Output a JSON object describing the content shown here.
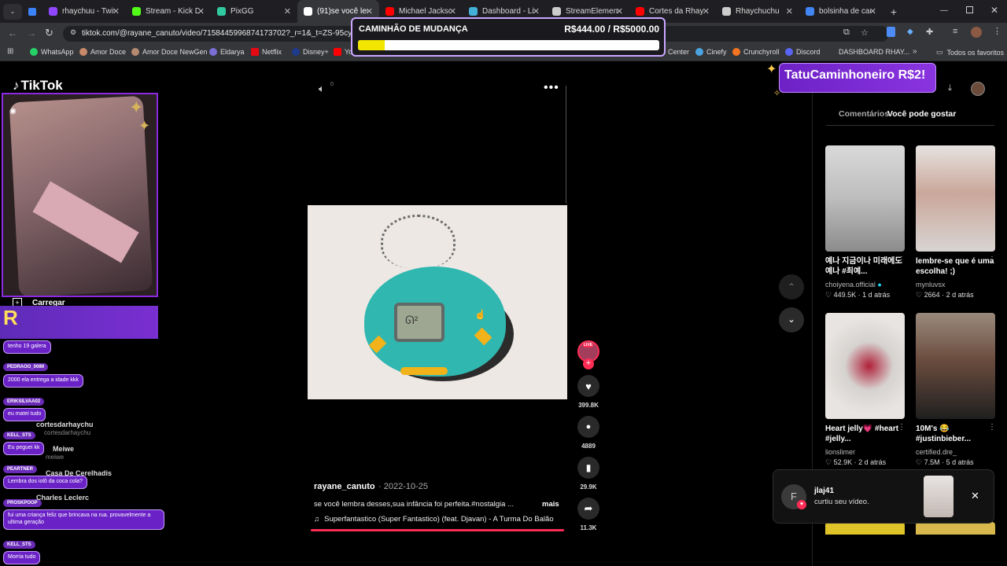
{
  "tabs": [
    {
      "label": "rhaychuu - Twitch",
      "color": "#9146ff"
    },
    {
      "label": "Stream - Kick Dashboard",
      "color": "#53fc18"
    },
    {
      "label": "PixGG",
      "color": "#30c9a0"
    },
    {
      "label": "(91)se você lembra",
      "color": "#ffffff"
    },
    {
      "label": "Michael Jackson",
      "color": "#ff0000"
    },
    {
      "label": "Dashboard - Live",
      "color": "#43b0d8"
    },
    {
      "label": "StreamElements",
      "color": "#cccccc"
    },
    {
      "label": "Cortes da Rhaych",
      "color": "#ff0000"
    },
    {
      "label": "Rhaychuchu",
      "color": "#cccccc"
    },
    {
      "label": "bolsinha de cach",
      "color": "#4285f4"
    }
  ],
  "address": {
    "url": "tiktok.com/@rayane_canuto/video/7158445996874173702?_r=1&_t=ZS-95cyIADV"
  },
  "bookmarks": [
    "WhatsApp",
    "Amor Doce",
    "Amor Doce NewGen",
    "Eldarya",
    "Netflix",
    "Disney+",
    "Yo",
    "Center",
    "Cinefy",
    "Crunchyroll",
    "Discord",
    "DASHBOARD RHAY...",
    "Todos os favoritos"
  ],
  "goal": {
    "title": "CAMINHÃO DE MUDANÇA",
    "amount": "R$444.00 / R$5000.00",
    "progress": 0.0888
  },
  "tiktok": {
    "logo": "TikTok",
    "upload": "Carregar"
  },
  "donation_banner": "TatuCaminhoneiro R$2!",
  "chat": [
    {
      "user": "",
      "text": "tenho 19 galera"
    },
    {
      "user": "PEDRAOO_00IM",
      "text": "2000 ela entrega a idade kkk"
    },
    {
      "user": "ERIKSILVAA02",
      "text": "eu matei tudo"
    },
    {
      "user": "KELL_STS",
      "text": "Eu peguei kk"
    },
    {
      "user": "PEARTNER",
      "text": "Lembra dos iolô da coca cola?"
    },
    {
      "user": "PROSKPOOP",
      "text": "fui uma criança feliz que brincava na rua. provavelmente a ultima geração"
    },
    {
      "user": "KELL_STS",
      "text": "Morria tudo"
    }
  ],
  "under_chat": [
    {
      "name": "cortesdarhaychu",
      "sub": "cortesdarhaychu"
    },
    {
      "name": "Meiwe",
      "sub": "meiwe"
    },
    {
      "name": "Casa De Cerelhadis",
      "sub": ""
    },
    {
      "name": "Charles Leclerc",
      "sub": "charles_leclerc"
    }
  ],
  "video": {
    "author": "rayane_canuto",
    "date": "2022-10-25",
    "caption": "se você lembra desses,sua infância foi perfeita.#nostalgia ...",
    "more": "mais",
    "music": "Superfantastico (Super Fantastico) (feat. Djavan) - A Turma Do Balão",
    "volume": "0",
    "live_badge": "LIVE"
  },
  "actions": [
    {
      "icon": "heart-icon",
      "count": "399.8K"
    },
    {
      "icon": "comment-icon",
      "count": "4889"
    },
    {
      "icon": "bookmark-icon",
      "count": "29.9K"
    },
    {
      "icon": "share-icon",
      "count": "11.3K"
    }
  ],
  "sidebar": {
    "tab_comments": "Comentários",
    "tab_suggestions": "Você pode gostar",
    "cards": [
      {
        "title": "예나 지금이나 미래에도 예나 #최예...",
        "author": "choiyena.official",
        "likes": "449.5K",
        "age": "1 d atrás",
        "verified": true
      },
      {
        "title": "lembre-se que é uma escolha! ;)",
        "author": "mynluvsx",
        "likes": "2664",
        "age": "2 d atrás",
        "verified": false
      },
      {
        "title": "Heart jelly💗 #heart #jelly...",
        "author": "lionslimer",
        "likes": "52.9K",
        "age": "2 d atrás",
        "verified": false
      },
      {
        "title": "10M's 😂 #justinbieber...",
        "author": "certified.dre_",
        "likes": "7.5M",
        "age": "5 d atrás",
        "verified": false
      }
    ]
  },
  "notification": {
    "user": "jlaj41",
    "message": "curtiu seu vídeo.",
    "avatar_letter": "F"
  }
}
